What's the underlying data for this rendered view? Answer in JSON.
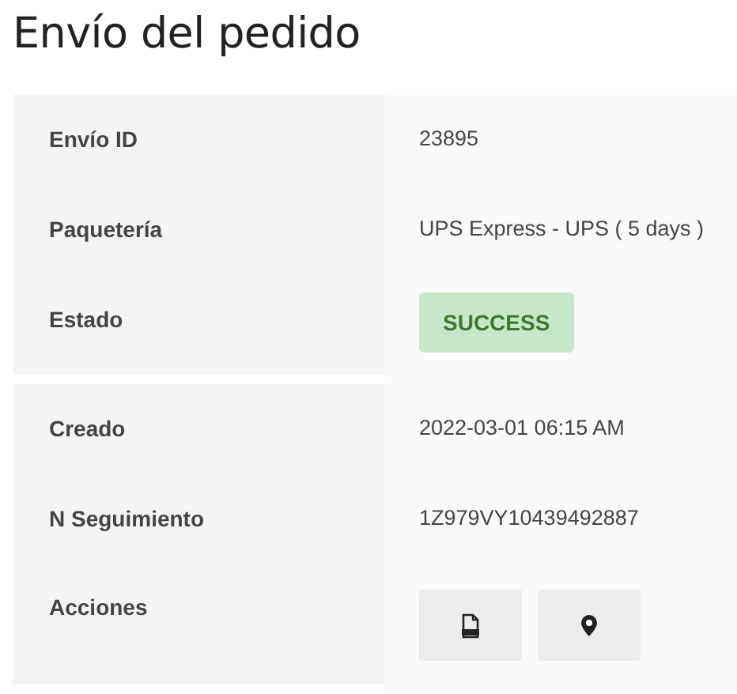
{
  "title": "Envío del pedido",
  "rows": [
    {
      "label": "Envío ID",
      "kind": "text",
      "value": "23895"
    },
    {
      "label": "Paquetería",
      "kind": "text",
      "value": "UPS Express - UPS ( 5 days )"
    },
    {
      "label": "Estado",
      "kind": "status",
      "value": "SUCCESS",
      "color": "#c8e6c9"
    },
    {
      "label": "Creado",
      "kind": "text",
      "value": "2022-03-01 06:15 AM"
    },
    {
      "label": "N Seguimiento",
      "kind": "text",
      "value": "1Z979VY10439492887"
    },
    {
      "label": "Acciones",
      "kind": "actions",
      "actions": [
        {
          "kind": "document"
        },
        {
          "kind": "pin"
        }
      ]
    }
  ]
}
